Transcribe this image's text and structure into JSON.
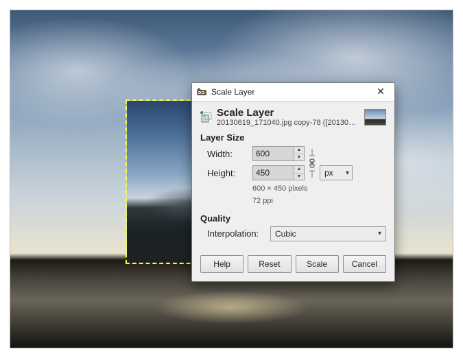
{
  "dialog": {
    "window_title": "Scale Layer",
    "header_title": "Scale Layer",
    "header_subtitle": "20130619_171040.jpg copy-78 ([20130701_...",
    "sections": {
      "layer_size": {
        "heading": "Layer Size",
        "width_label": "Width:",
        "height_label": "Height:",
        "width_value": "600",
        "height_value": "450",
        "unit_selected": "px",
        "info_dims": "600 × 450 pixels",
        "info_res": "72 ppi",
        "chain_linked": true
      },
      "quality": {
        "heading": "Quality",
        "interp_label": "Interpolation:",
        "interp_selected": "Cubic"
      }
    },
    "buttons": {
      "help": "Help",
      "reset": "Reset",
      "scale": "Scale",
      "cancel": "Cancel"
    }
  },
  "icons": {
    "app": "gimp-icon",
    "dlg": "scale-icon",
    "chain": "chain-link-icon",
    "close": "close-icon",
    "chev": "chevron-down-icon"
  }
}
